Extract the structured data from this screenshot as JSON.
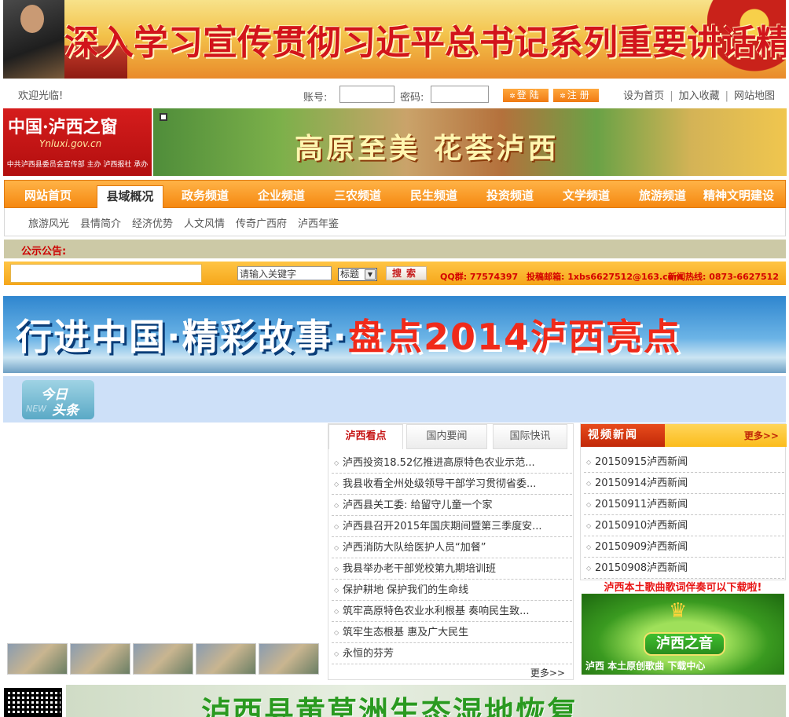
{
  "top_banner": {
    "title": "深入学习宣传贯彻习近平总书记系列重要讲话精神"
  },
  "login": {
    "welcome": "欢迎光临!",
    "account_label": "账号:",
    "password_label": "密码:",
    "login_button": "登陆",
    "register_button": "注册",
    "set_home": "设为首页",
    "add_favorite": "加入收藏",
    "site_map": "网站地图",
    "separator": "|"
  },
  "logo": {
    "line1": "中国·泸西之窗",
    "line2": "Ynluxi.gov.cn",
    "line3": "中共泸西县委员会宣传部 主办  泸西报社 承办"
  },
  "header_banner": {
    "slogan": "高原至美  花荟泸西"
  },
  "main_nav": {
    "items": [
      "网站首页",
      "县域概况",
      "政务频道",
      "企业频道",
      "三农频道",
      "民生频道",
      "投资频道",
      "文学频道",
      "旅游频道",
      "精神文明建设"
    ],
    "active_index": 1
  },
  "sub_nav": {
    "items": [
      "旅游风光",
      "县情简介",
      "经济优势",
      "人文风情",
      "传奇广西府",
      "泸西年鉴"
    ]
  },
  "notice": {
    "label": "公示公告:"
  },
  "search": {
    "placeholder": "请输入关键字",
    "scope": "标题",
    "button": "搜索",
    "qq": "QQ群: 77574397",
    "email": "投稿邮箱: 1xbs6627512@163.com",
    "hotline": "新闻热线: 0873-6627512"
  },
  "feature_banner": {
    "text_main": "行进中国·精彩故事·",
    "text_accent": "盘点2014泸西亮点"
  },
  "headline": {
    "line1": "今日",
    "line2": "头条",
    "en": "NEW"
  },
  "news_tabs": {
    "tabs": [
      "泸西看点",
      "国内要闻",
      "国际快讯"
    ],
    "active_index": 0,
    "items": [
      "泸西投资18.52亿推进高原特色农业示范...",
      "我县收看全州处级领导干部学习贯彻省委...",
      "泸西县关工委: 给留守儿童一个家",
      "泸西县召开2015年国庆期间暨第三季度安...",
      "泸西消防大队给医护人员“加餐”",
      "我县举办老干部党校第九期培训班",
      "保护耕地  保护我们的生命线",
      "筑牢高原特色农业水利根基  奏响民生致...",
      "筑牢生态根基  惠及广大民生",
      "永恒的芬芳"
    ],
    "more": "更多>>"
  },
  "video_news": {
    "title": "视频新闻",
    "more": "更多>>",
    "items": [
      "20150915泸西新闻",
      "20150914泸西新闻",
      "20150911泸西新闻",
      "20150910泸西新闻",
      "20150909泸西新闻",
      "20150908泸西新闻"
    ]
  },
  "song_note": "泸西本土歌曲歌词伴奏可以下载啦!",
  "music_ad": {
    "title": "泸西之音",
    "line": "泸西  本土原创歌曲  下载中心"
  },
  "bottom_banner": {
    "title": "泸西县黄草洲生态湿地恢复"
  }
}
